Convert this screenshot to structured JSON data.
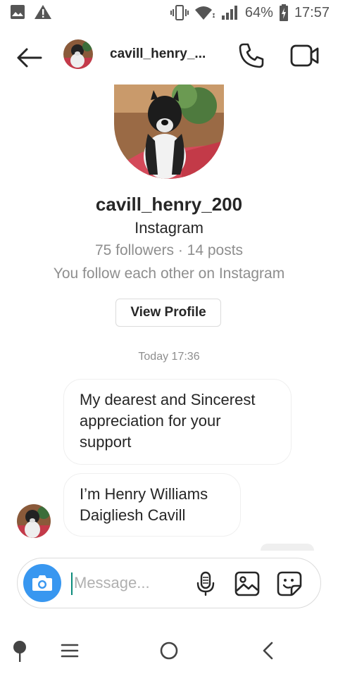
{
  "status_bar": {
    "battery": "64%",
    "time": "17:57",
    "icons": [
      "image-icon",
      "warning-icon",
      "vibrate-icon",
      "wifi-icon",
      "signal-icon",
      "battery-charging-icon"
    ]
  },
  "header": {
    "username": "cavill_henry_...",
    "icons": [
      "back-arrow-icon",
      "phone-icon",
      "video-camera-icon"
    ]
  },
  "profile": {
    "username": "cavill_henry_200",
    "subtitle": "Instagram",
    "stats": "75 followers · 14 posts",
    "follow_status": "You follow each other on Instagram",
    "view_profile_label": "View Profile"
  },
  "conversation": {
    "timestamp": "Today 17:36",
    "messages": [
      {
        "text": "My dearest and Sincerest appreciation for your support"
      },
      {
        "text": "I’m Henry Williams Daigliesh Cavill"
      }
    ]
  },
  "composer": {
    "placeholder": "Message...",
    "icons": [
      "camera-icon",
      "microphone-icon",
      "gallery-icon",
      "sticker-icon"
    ]
  },
  "nav_bar": {
    "icons": [
      "assistant-pin-icon",
      "recents-icon",
      "home-icon",
      "back-icon"
    ]
  },
  "colors": {
    "accent": "#3897f0",
    "secondary_text": "#8e8e8e",
    "primary_text": "#262626",
    "border": "#dbdbdb"
  }
}
